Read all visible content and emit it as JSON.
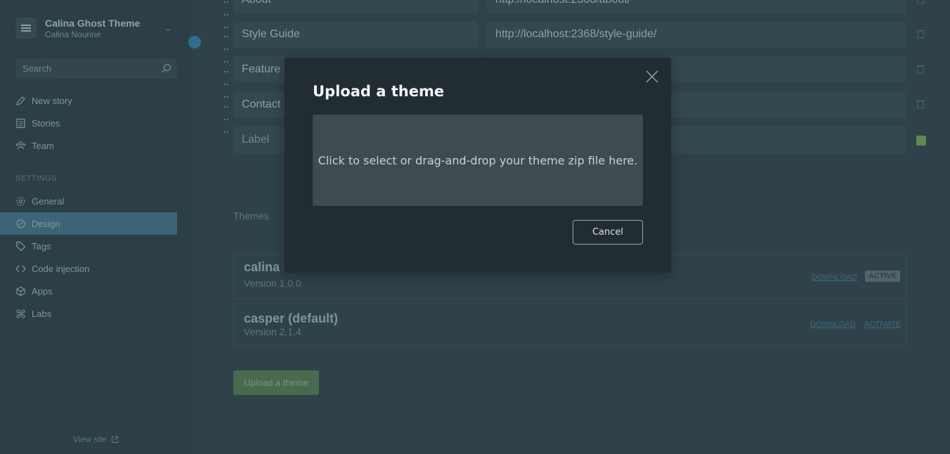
{
  "sidebar": {
    "blog_title": "Calina Ghost Theme",
    "blog_user": "Calina Nourine",
    "search_placeholder": "Search",
    "nav": [
      {
        "label": "New story",
        "icon": "pencil-icon"
      },
      {
        "label": "Stories",
        "icon": "document-icon"
      },
      {
        "label": "Team",
        "icon": "team-icon"
      }
    ],
    "settings_header": "SETTINGS",
    "settings": [
      {
        "label": "General",
        "icon": "gear-icon"
      },
      {
        "label": "Design",
        "icon": "design-icon",
        "active": true
      },
      {
        "label": "Tags",
        "icon": "tag-icon"
      },
      {
        "label": "Code injection",
        "icon": "code-icon"
      },
      {
        "label": "Apps",
        "icon": "apps-icon"
      },
      {
        "label": "Labs",
        "icon": "labs-icon"
      }
    ],
    "view_site": "View site"
  },
  "navigation": {
    "rows": [
      {
        "label": "About",
        "url": "http://localhost:2368/about/"
      },
      {
        "label": "Style Guide",
        "url": "http://localhost:2368/style-guide/"
      },
      {
        "label": "Feature",
        "url": ""
      },
      {
        "label": "Contact",
        "url": ""
      }
    ],
    "new_label_placeholder": "Label"
  },
  "themes": {
    "header": "Themes",
    "list": [
      {
        "name": "calina",
        "version": "Version 1.0.0",
        "download": "DOWNLOAD",
        "status": "ACTIVE"
      },
      {
        "name": "casper (default)",
        "version": "Version 2.1.4",
        "download": "DOWNLOAD",
        "status": "ACTIVATE"
      }
    ],
    "upload_button": "Upload a theme"
  },
  "modal": {
    "title": "Upload a theme",
    "dropzone_text": "Click to select or drag-and-drop your theme zip file here.",
    "cancel_button": "Cancel"
  },
  "colors": {
    "modal_bg": "#212c33",
    "dropzone_bg": "#3f4b51",
    "active_nav": "#3b6575",
    "upload_green": "#4a6a4e"
  }
}
